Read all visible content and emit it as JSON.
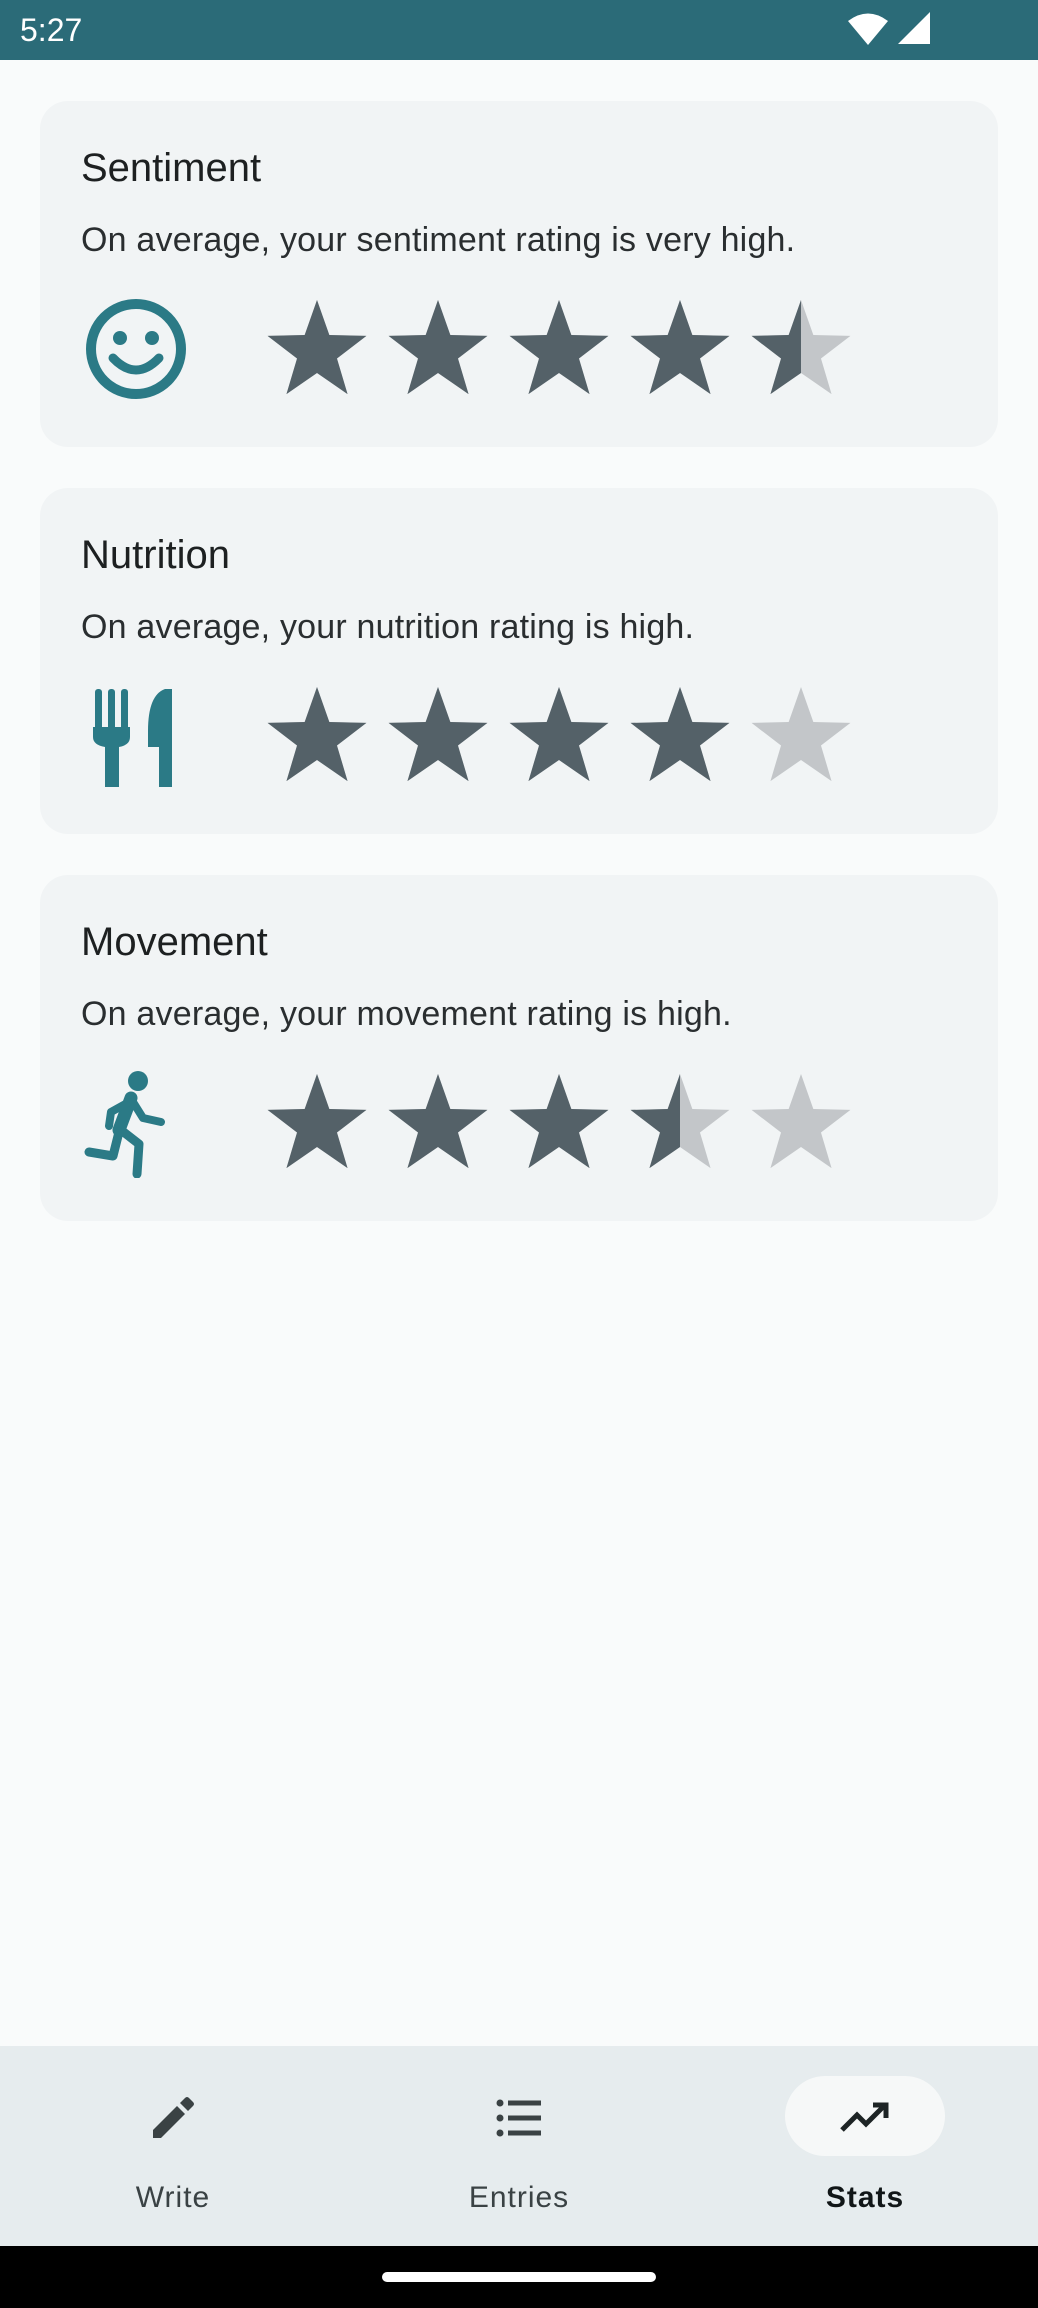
{
  "status_bar": {
    "time": "5:27",
    "icons": [
      "wifi-icon",
      "signal-icon"
    ]
  },
  "colors": {
    "accent": "#2b7a86",
    "star_filled": "#546168",
    "star_empty": "#c3c6c9",
    "status_bar": "#2b6b78"
  },
  "cards": [
    {
      "title": "Sentiment",
      "description": "On average, your sentiment rating is very high.",
      "icon": "smiley-face-icon",
      "rating": 4.5,
      "max_rating": 5
    },
    {
      "title": "Nutrition",
      "description": "On average, your nutrition rating is high.",
      "icon": "fork-knife-icon",
      "rating": 4,
      "max_rating": 5
    },
    {
      "title": "Movement",
      "description": "On average, your movement rating is high.",
      "icon": "running-person-icon",
      "rating": 3.5,
      "max_rating": 5
    }
  ],
  "bottom_nav": {
    "items": [
      {
        "label": "Write",
        "icon": "pencil-icon",
        "active": false
      },
      {
        "label": "Entries",
        "icon": "list-icon",
        "active": false
      },
      {
        "label": "Stats",
        "icon": "trending-up-icon",
        "active": true
      }
    ]
  }
}
